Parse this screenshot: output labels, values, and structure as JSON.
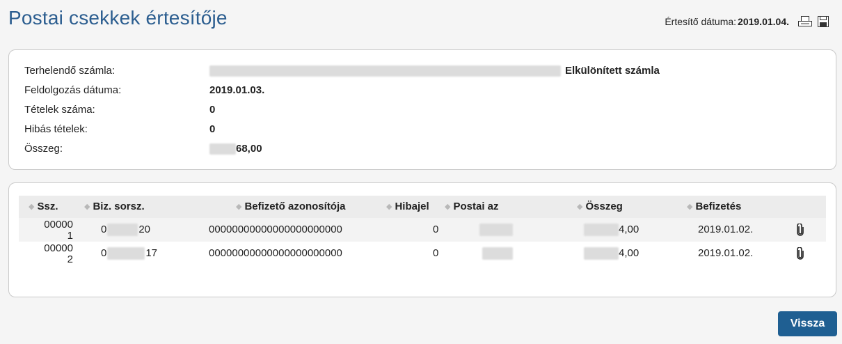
{
  "title": "Postai csekkek értesítője",
  "notice": {
    "label": "Értesítő dátuma:",
    "value": "2019.01.04."
  },
  "summary": {
    "account_label": "Terhelendő számla:",
    "account_suffix": "Elkülönített számla",
    "processing_label": "Feldolgozás dátuma:",
    "processing_value": "2019.01.03.",
    "items_label": "Tételek száma:",
    "items_value": "0",
    "errors_label": "Hibás tételek:",
    "errors_value": "0",
    "amount_label": "Összeg:",
    "amount_value": "68,00"
  },
  "table": {
    "headers": {
      "ssz": "Ssz.",
      "biz": "Biz. sorsz.",
      "befizeto": "Befizető azonosítója",
      "hibajel": "Hibajel",
      "postai": "Postai az",
      "osszeg": "Összeg",
      "befizetes": "Befizetés"
    },
    "rows": [
      {
        "ssz_a": "00000",
        "ssz_b": "1",
        "biz_pre": "0",
        "biz_post": "20",
        "befizeto": "00000000000000000000000",
        "hibajel": "0",
        "osszeg": "4,00",
        "datum": "2019.01.02."
      },
      {
        "ssz_a": "00000",
        "ssz_b": "2",
        "biz_pre": "0",
        "biz_post": "17",
        "befizeto": "00000000000000000000000",
        "hibajel": "0",
        "osszeg": "4,00",
        "datum": "2019.01.02."
      }
    ]
  },
  "back_button": "Vissza"
}
